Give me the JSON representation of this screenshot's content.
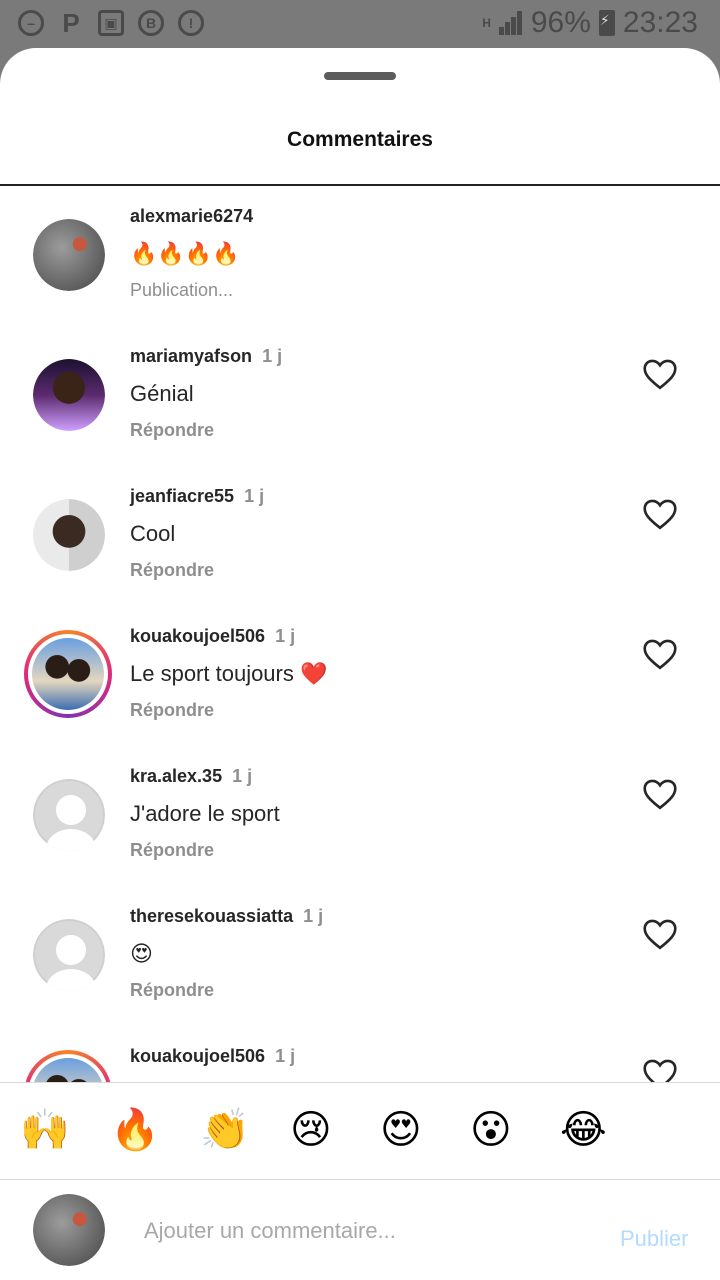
{
  "status_bar": {
    "battery": "96%",
    "time": "23:23",
    "network": "H"
  },
  "sheet": {
    "title": "Commentaires"
  },
  "comments": [
    {
      "user": "alexmarie6274",
      "time": "",
      "text": "🔥🔥🔥🔥",
      "action": "Publication...",
      "avatar": "ph-grey",
      "story": false,
      "heart": false
    },
    {
      "user": "mariamyafson",
      "time": "1 j",
      "text": "Génial",
      "action": "Répondre",
      "avatar": "ph-woman",
      "story": false,
      "heart": true
    },
    {
      "user": "jeanfiacre55",
      "time": "1 j",
      "text": "Cool",
      "action": "Répondre",
      "avatar": "ph-man",
      "story": false,
      "heart": true
    },
    {
      "user": "kouakoujoel506",
      "time": "1 j",
      "text": "Le sport toujours ❤️",
      "action": "Répondre",
      "avatar": "ph-group",
      "story": true,
      "heart": true
    },
    {
      "user": "kra.alex.35",
      "time": "1 j",
      "text": "J'adore le sport",
      "action": "Répondre",
      "avatar": "ph-default",
      "story": false,
      "heart": true
    },
    {
      "user": "theresekouassiatta",
      "time": "1 j",
      "text": "😍",
      "action": "Répondre",
      "avatar": "ph-default",
      "story": false,
      "heart": true
    },
    {
      "user": "kouakoujoel506",
      "time": "1 j",
      "text": "",
      "action": "",
      "avatar": "ph-group",
      "story": true,
      "heart": true
    }
  ],
  "emoji_bar": [
    "🙌",
    "🔥",
    "👏",
    "😢",
    "😍",
    "😮",
    "😂"
  ],
  "composer": {
    "placeholder": "Ajouter un commentaire...",
    "publish": "Publier"
  },
  "colors": {
    "accent_disabled": "#b3dbff",
    "muted": "#8e8e8e",
    "text": "#262626"
  }
}
